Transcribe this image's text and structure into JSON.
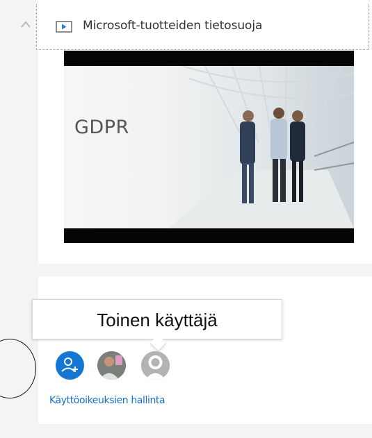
{
  "link_row": {
    "label": "Microsoft-tuotteiden tietosuoja",
    "icon": "video-play-icon"
  },
  "collapse_icon": "chevron-up-icon",
  "video": {
    "title": "GDPR"
  },
  "tooltip": {
    "text": "Toinen käyttäjä"
  },
  "sharing": {
    "add_user_icon": "add-person-icon",
    "avatars": [
      "add-user",
      "user-photo",
      "generic-user"
    ],
    "manage_link": "Käyttöoikeuksien hallinta"
  },
  "colors": {
    "accent": "#1477d4",
    "link": "#1a6fc9",
    "text": "#333333",
    "background": "#f4f4f4"
  }
}
